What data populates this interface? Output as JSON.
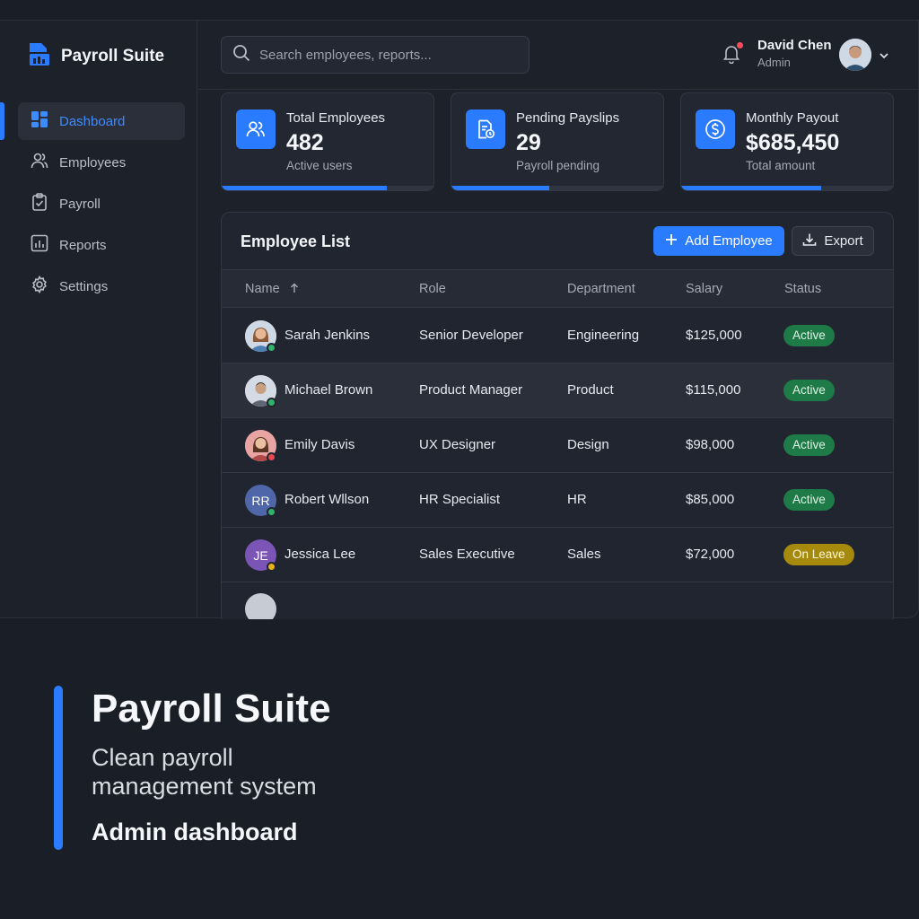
{
  "app": {
    "brand": "Payroll Suite"
  },
  "sidebar": {
    "items": [
      {
        "label": "Dashboard",
        "icon": "dashboard-icon",
        "active": true
      },
      {
        "label": "Employees",
        "icon": "users-icon"
      },
      {
        "label": "Payroll",
        "icon": "clipboard-icon"
      },
      {
        "label": "Reports",
        "icon": "chart-icon"
      },
      {
        "label": "Settings",
        "icon": "gear-icon"
      }
    ]
  },
  "header": {
    "search_placeholder": "Search employees, reports...",
    "user_name": "David Chen",
    "user_role": "Admin"
  },
  "stats": [
    {
      "title": "Total Employees",
      "value": "482",
      "sub": "Active users",
      "progress": 0.78
    },
    {
      "title": "Pending Payslips",
      "value": "29",
      "sub": "Payroll pending",
      "progress": 0.46
    },
    {
      "title": "Monthly Payout",
      "value": "$685,450",
      "sub": "Total amount",
      "progress": 0.66
    }
  ],
  "employee_list": {
    "title": "Employee List",
    "add_label": "Add Employee",
    "export_label": "Export",
    "columns": {
      "name": "Name",
      "role": "Role",
      "department": "Department",
      "salary": "Salary",
      "status": "Status"
    },
    "rows": [
      {
        "name": "Sarah Jenkins",
        "role": "Senior Developer",
        "department": "Engineering",
        "salary": "$125,000",
        "status": "Active"
      },
      {
        "name": "Michael Brown",
        "role": "Product Manager",
        "department": "Product",
        "salary": "$115,000",
        "status": "Active"
      },
      {
        "name": "Emily Davis",
        "role": "UX Designer",
        "department": "Design",
        "salary": "$98,000",
        "status": "Active"
      },
      {
        "name": "Robert Wllson",
        "role": "HR Specialist",
        "department": "HR",
        "salary": "$85,000",
        "status": "Active",
        "initials": "RR"
      },
      {
        "name": "Jessica Lee",
        "role": "Sales Executive",
        "department": "Sales",
        "salary": "$72,000",
        "status": "On Leave",
        "initials": "JE"
      }
    ]
  },
  "hero": {
    "title": "Payroll Suite",
    "subtitle": "Clean payroll management system",
    "tagline": "Admin dashboard"
  },
  "colors": {
    "accent": "#2b7bff",
    "active_badge": "#1e7a47",
    "leave_badge": "#a58a0e",
    "background": "#1a1e26"
  }
}
